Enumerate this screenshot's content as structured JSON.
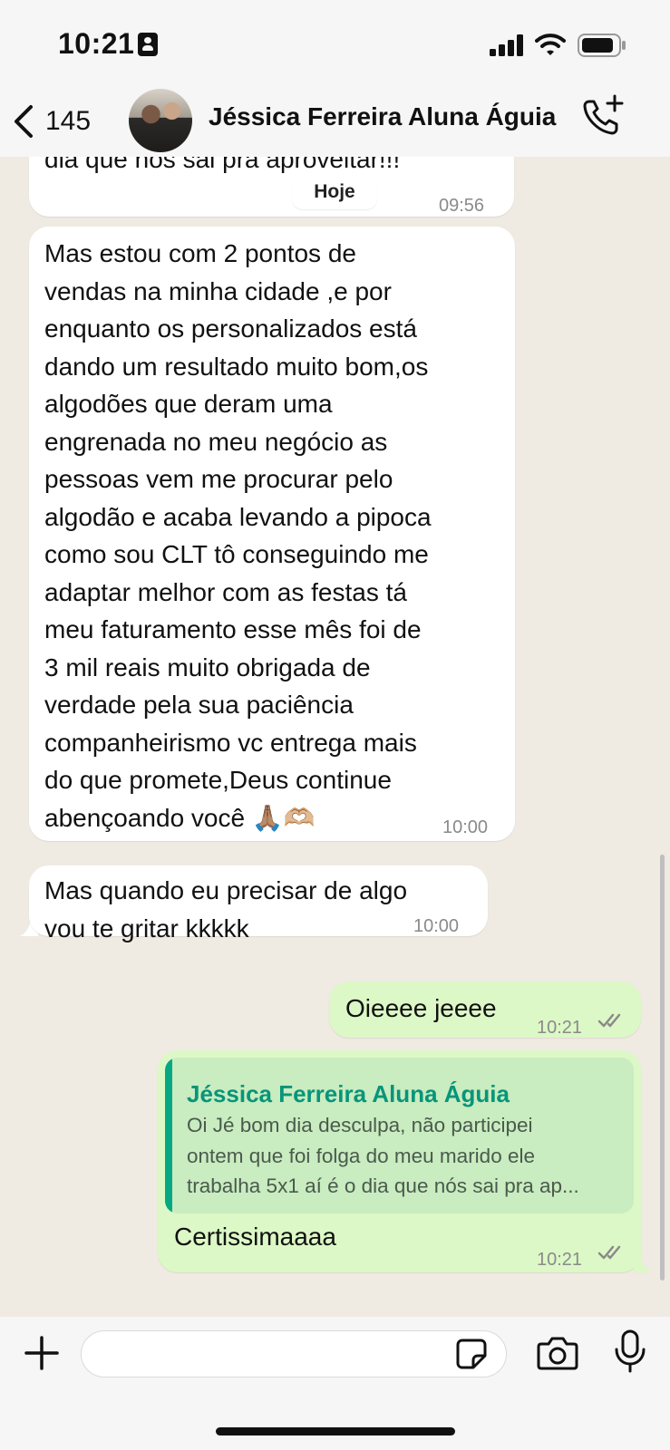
{
  "status_bar": {
    "time": "10:21"
  },
  "header": {
    "back_count": "145",
    "contact_name": "Jéssica Ferreira Aluna Águia"
  },
  "chat": {
    "date_separator": "Hoje",
    "messages": [
      {
        "direction": "in",
        "text": "dia que nós sai pra aproveitar!!!",
        "time": "09:56"
      },
      {
        "direction": "in",
        "text": "Mas estou com 2 pontos de\nvendas na minha cidade ,e por\nenquanto os personalizados está\ndando um resultado muito bom,os\nalgodões que deram uma\nengrenada no meu negócio as\npessoas vem me procurar pelo\nalgodão e acaba levando a pipoca\ncomo sou CLT tô conseguindo me\nadaptar melhor com as festas tá\nmeu faturamento esse mês foi de\n3 mil reais muito obrigada de\nverdade pela sua paciência\ncompanheirismo vc entrega mais\ndo que promete,Deus continue\nabençoando você 🙏🏽🫶🏼",
        "time": "10:00"
      },
      {
        "direction": "in",
        "text": "Mas quando eu precisar de algo\nvou te gritar kkkkk",
        "time": "10:00"
      },
      {
        "direction": "out",
        "text": "Oieeee jeeee",
        "time": "10:21",
        "status": "read"
      },
      {
        "direction": "out",
        "text": "Certissimaaaa",
        "time": "10:21",
        "status": "read",
        "quote": {
          "author": "Jéssica Ferreira Aluna Águia",
          "text": "Oi Jé bom dia desculpa, não participei\nontem que foi folga do meu marido ele\ntrabalha 5x1 aí é o dia que nós sai pra ap..."
        }
      }
    ]
  },
  "composer": {
    "placeholder": ""
  },
  "colors": {
    "background": "#efeae2",
    "incoming_bubble": "#ffffff",
    "outgoing_bubble": "#dcf8c6",
    "quote_accent": "#06a884"
  }
}
